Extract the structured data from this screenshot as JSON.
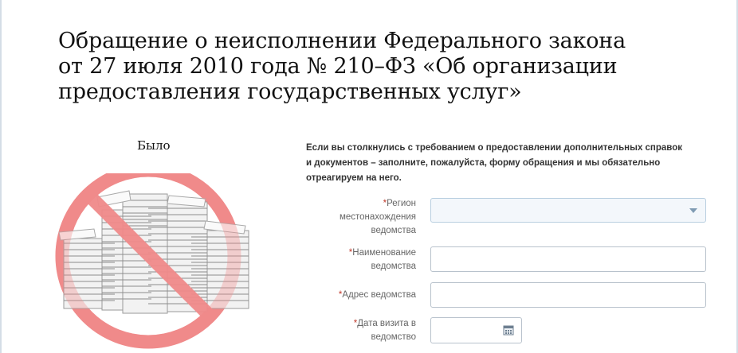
{
  "page": {
    "title_line1": "Обращение о неисполнении Федерального закона",
    "title_line2": "от 27 июля 2010 года № 210–ФЗ «Об организации",
    "title_line3": "предоставления государственных услуг»"
  },
  "illustration": {
    "label": "Было",
    "icon": "no-paper-stacks-icon",
    "sign_color": "#f08a8a"
  },
  "form": {
    "intro_line1": "Если вы столкнулись с требованием о предоставлении дополнительных справок",
    "intro_line2": "и документов – заполните, пожалуйста, форму обращения и мы обязательно",
    "intro_line3": "отреагируем на него.",
    "required_mark": "*",
    "fields": [
      {
        "label_line1": "Регион",
        "label_line2": "местонахождения",
        "label_line3": "ведомства",
        "type": "select",
        "value": ""
      },
      {
        "label_line1": "Наименование",
        "label_line2": "ведомства",
        "type": "text",
        "value": ""
      },
      {
        "label_line1": "Адрес ведомства",
        "type": "text",
        "value": ""
      },
      {
        "label_line1": "Дата визита в",
        "label_line2": "ведомство",
        "type": "date",
        "value": ""
      }
    ]
  },
  "colors": {
    "required": "#c0392b",
    "field_border": "#b8c2cc",
    "select_bg": "#f3f7fb"
  }
}
